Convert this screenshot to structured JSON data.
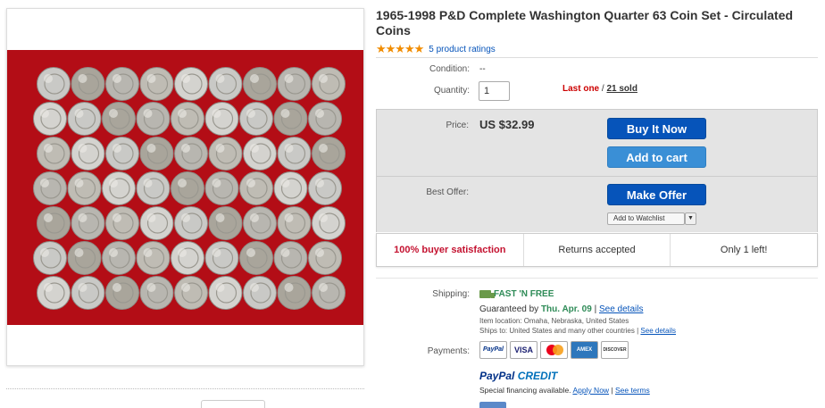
{
  "listing": {
    "title": "1965-1998 P&D Complete Washington Quarter 63 Coin Set - Circulated Coins",
    "stars": "★★★★★",
    "rating_text": "5 product ratings"
  },
  "details": {
    "condition_label": "Condition:",
    "condition_value": "--",
    "quantity_label": "Quantity:",
    "quantity_value": "1",
    "last_one": "Last one",
    "stock_sep": " / ",
    "sold": "21 sold"
  },
  "buy_box": {
    "price_label": "Price:",
    "price_value": "US $32.99",
    "buy_now": "Buy It Now",
    "add_to_cart": "Add to cart",
    "best_offer_label": "Best Offer:",
    "make_offer": "Make Offer",
    "watchlist": "Add to Watchlist",
    "watchlist_arrow": "▼"
  },
  "features": {
    "satisfaction": "100% buyer satisfaction",
    "returns": "Returns accepted",
    "remaining": "Only 1 left!"
  },
  "shipping": {
    "label": "Shipping:",
    "free": "FAST 'N FREE",
    "guaranteed_prefix": "Guaranteed by ",
    "guaranteed_date": "Thu. Apr. 09",
    "guaranteed_sep": " | ",
    "see_details": "See details",
    "item_location": "Item location:  Omaha, Nebraska, United States",
    "ships_to": "Ships to:  United States and many other countries",
    "ships_sep": " | ",
    "ships_details": "See details"
  },
  "payments": {
    "label": "Payments:",
    "methods": [
      "PayPal",
      "VISA",
      "MC",
      "AMEX",
      "DISCOVER"
    ],
    "paypal_credit_1": "PayPal",
    "paypal_credit_2": " CREDIT",
    "financing": "Special financing available.  ",
    "apply_now": "Apply Now",
    "fin_sep": "  |  ",
    "see_terms": "See terms"
  },
  "colors": {
    "accent": "#0654ba",
    "cart": "#3a8fd6",
    "stars": "#f18c00",
    "photo_bg": "#b30d16",
    "alert": "#c41230",
    "free_shipping": "#2e8b57"
  }
}
